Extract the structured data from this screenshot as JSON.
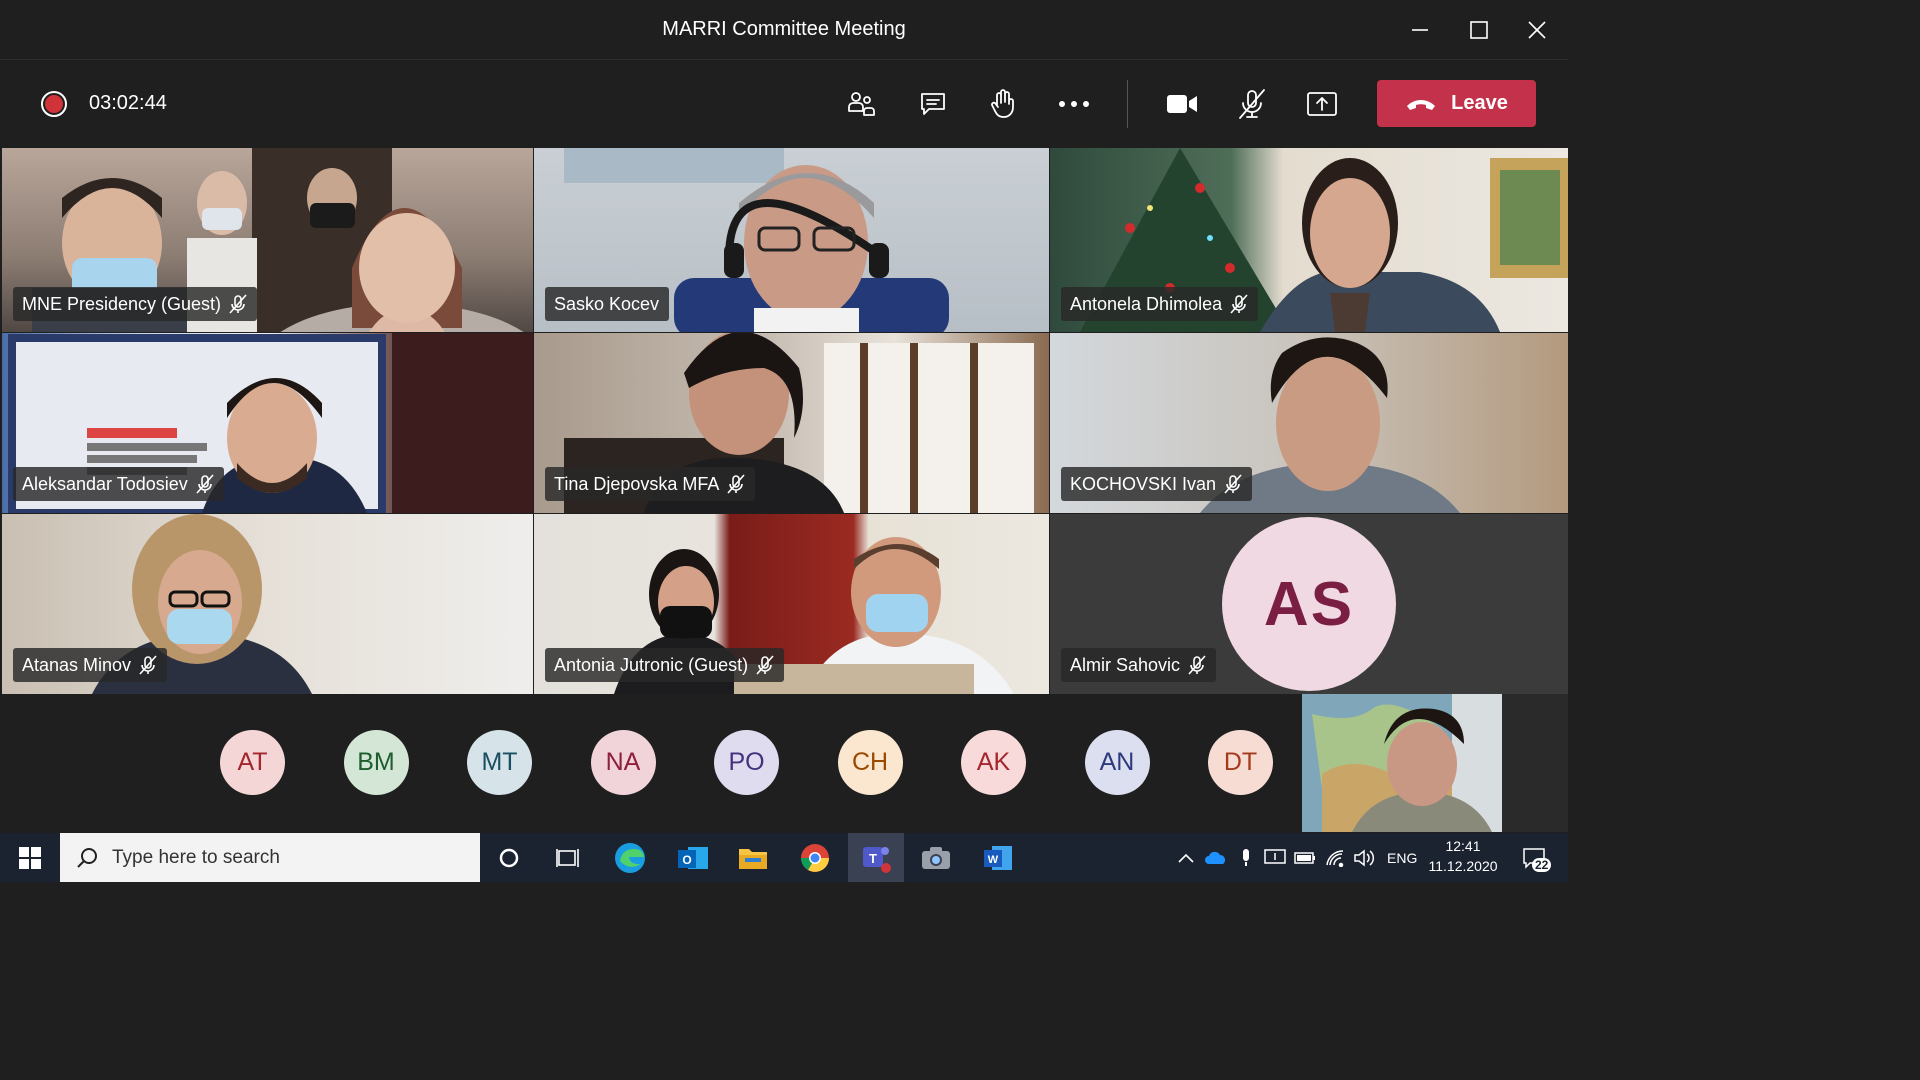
{
  "window": {
    "title": "MARRI Committee Meeting"
  },
  "toolbar": {
    "timer": "03:02:44",
    "leave_label": "Leave"
  },
  "participants": [
    {
      "name": "MNE Presidency (Guest)",
      "muted": true
    },
    {
      "name": "Sasko Kocev",
      "muted": false
    },
    {
      "name": "Antonela Dhimolea",
      "muted": true
    },
    {
      "name": "Aleksandar Todosiev",
      "muted": true
    },
    {
      "name": "Tina Djepovska MFA",
      "muted": true
    },
    {
      "name": "KOCHOVSKI Ivan",
      "muted": true
    },
    {
      "name": "Atanas Minov",
      "muted": true
    },
    {
      "name": "Antonia Jutronic (Guest)",
      "muted": true
    },
    {
      "name": "Almir Sahovic",
      "muted": true,
      "initials": "AS"
    }
  ],
  "roster": [
    {
      "initials": "AT",
      "bg": "#f5d6d6",
      "fg": "#a4262c"
    },
    {
      "initials": "BM",
      "bg": "#d4e6d6",
      "fg": "#1e5e2e"
    },
    {
      "initials": "MT",
      "bg": "#d6e4ea",
      "fg": "#1c4e63"
    },
    {
      "initials": "NA",
      "bg": "#f0d4da",
      "fg": "#8e1e3a"
    },
    {
      "initials": "PO",
      "bg": "#e0dcf0",
      "fg": "#44327e"
    },
    {
      "initials": "CH",
      "bg": "#fbe6cf",
      "fg": "#9a4a00"
    },
    {
      "initials": "AK",
      "bg": "#f8dada",
      "fg": "#a4262c"
    },
    {
      "initials": "AN",
      "bg": "#dcdff0",
      "fg": "#2e3a7e"
    },
    {
      "initials": "DT",
      "bg": "#f7dcd4",
      "fg": "#a23b1c"
    }
  ],
  "taskbar": {
    "search_placeholder": "Type here to search",
    "language": "ENG",
    "time": "12:41",
    "date": "11.12.2020",
    "notification_count": "22"
  },
  "colors": {
    "leave": "#c4314b",
    "recording": "#d13438",
    "background": "#1f1f1f"
  }
}
